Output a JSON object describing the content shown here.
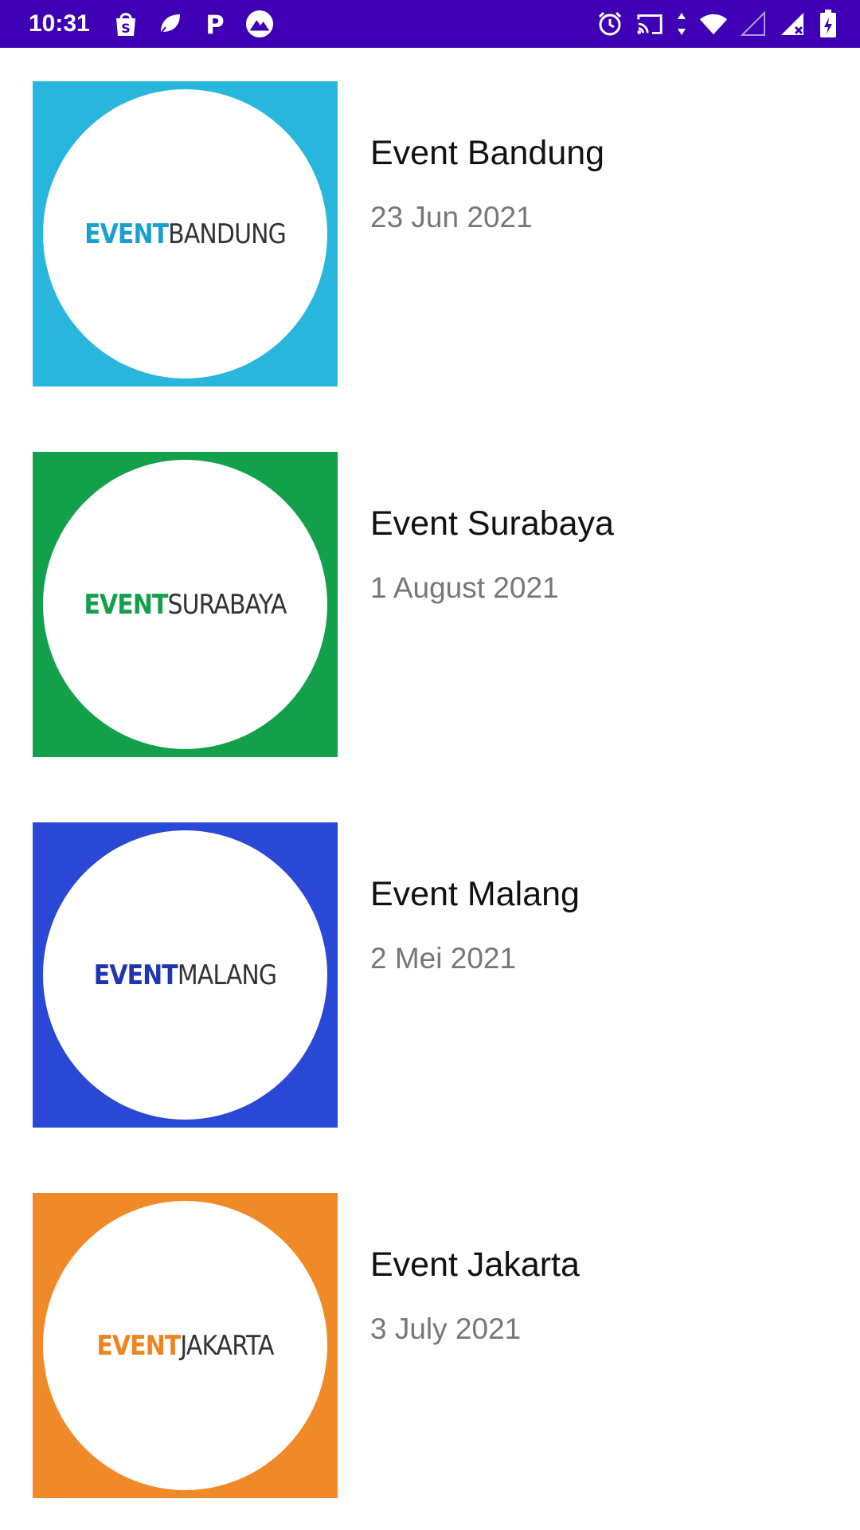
{
  "status_bar": {
    "time": "10:31",
    "background": "#3f00b5",
    "left_icons": [
      "shopee-icon",
      "chat-bubble-icon",
      "p-app-icon",
      "mountain-app-icon"
    ],
    "right_icons": [
      "alarm-icon",
      "cast-icon",
      "data-arrows-icon",
      "wifi-icon",
      "cell-signal-icon",
      "cell-signal-x-icon",
      "battery-icon"
    ]
  },
  "events": [
    {
      "title": "Event Bandung",
      "date": "23 Jun 2021",
      "logo_event": "EVENT",
      "logo_city": "BANDUNG",
      "color": "#29b6dd",
      "logo_accent": "#1aa0d0"
    },
    {
      "title": "Event Surabaya",
      "date": "1 August 2021",
      "logo_event": "EVENT",
      "logo_city": "SURABAYA",
      "color": "#12a04a",
      "logo_accent": "#12a04a"
    },
    {
      "title": "Event Malang",
      "date": "2 Mei 2021",
      "logo_event": "EVENT",
      "logo_city": "MALANG",
      "color": "#2a48d6",
      "logo_accent": "#1f36b0"
    },
    {
      "title": "Event Jakarta",
      "date": "3 July 2021",
      "logo_event": "EVENT",
      "logo_city": "JAKARTA",
      "color": "#f08a28",
      "logo_accent": "#ef8420"
    }
  ]
}
